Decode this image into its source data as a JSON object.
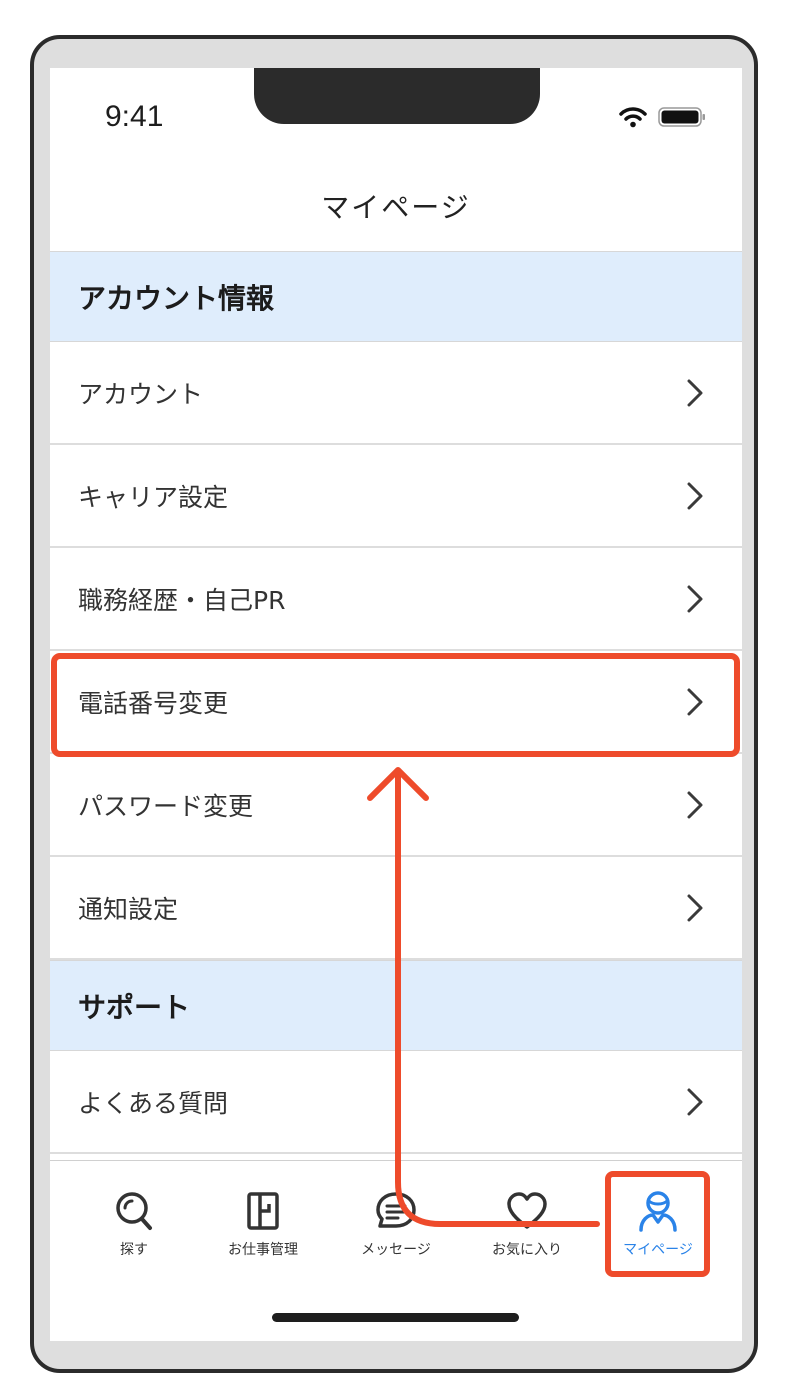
{
  "status_bar": {
    "time": "9:41",
    "icons": [
      "wifi-icon",
      "battery-icon"
    ]
  },
  "header": {
    "title": "マイページ"
  },
  "sections": [
    {
      "title": "アカウント情報",
      "items": [
        "アカウント",
        "キャリア設定",
        "職務経歴・自己PR",
        "電話番号変更",
        "パスワード変更",
        "通知設定"
      ]
    },
    {
      "title": "サポート",
      "items": [
        "よくある質問"
      ]
    }
  ],
  "tabbar": {
    "tabs": [
      {
        "label": "探す",
        "icon": "search-icon"
      },
      {
        "label": "お仕事管理",
        "icon": "door-icon"
      },
      {
        "label": "メッセージ",
        "icon": "message-icon"
      },
      {
        "label": "お気に入り",
        "icon": "heart-icon"
      },
      {
        "label": "マイページ",
        "icon": "person-icon",
        "active": true
      }
    ]
  },
  "colors": {
    "accent": "#2a83e8",
    "highlight": "#ee4b2b",
    "section_bg": "#dfedfc"
  }
}
